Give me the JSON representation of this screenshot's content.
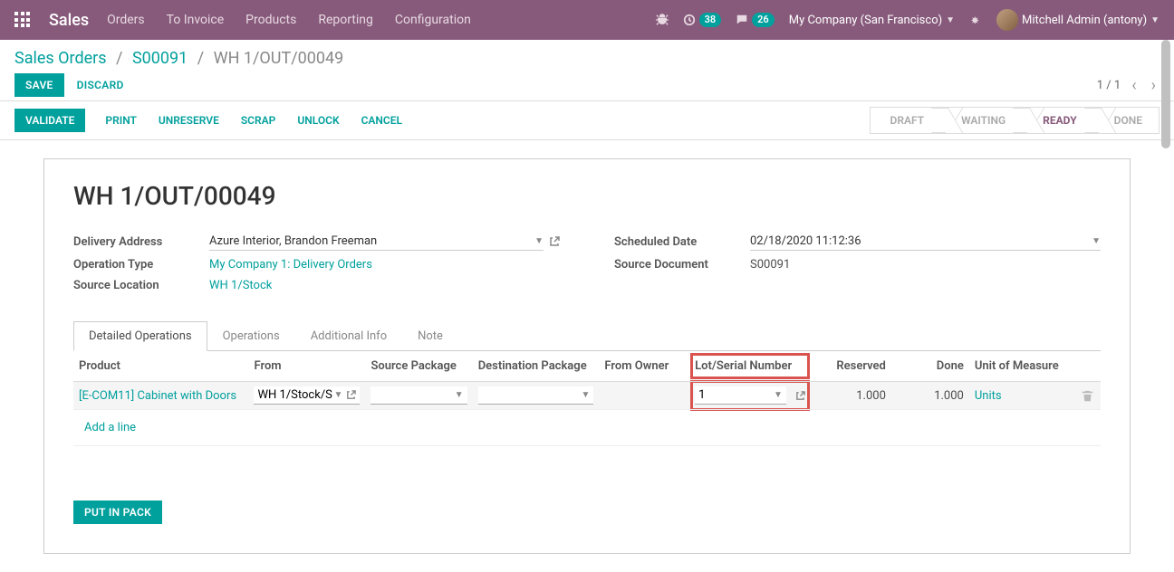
{
  "nav": {
    "brand": "Sales",
    "menu": [
      "Orders",
      "To Invoice",
      "Products",
      "Reporting",
      "Configuration"
    ],
    "activities_count": "38",
    "messages_count": "26",
    "company": "My Company (San Francisco)",
    "user": "Mitchell Admin (antony)"
  },
  "breadcrumb": {
    "level1": "Sales Orders",
    "level2": "S00091",
    "level3": "WH 1/OUT/00049"
  },
  "buttons": {
    "save": "SAVE",
    "discard": "DISCARD",
    "validate": "VALIDATE",
    "print": "PRINT",
    "unreserve": "UNRESERVE",
    "scrap": "SCRAP",
    "unlock": "UNLOCK",
    "cancel": "CANCEL",
    "put_in_pack": "PUT IN PACK"
  },
  "pager": {
    "text": "1 / 1"
  },
  "status": {
    "steps": [
      "DRAFT",
      "WAITING",
      "READY",
      "DONE"
    ],
    "active_index": 2
  },
  "record": {
    "title": "WH 1/OUT/00049",
    "delivery_address_label": "Delivery Address",
    "delivery_address": "Azure Interior, Brandon Freeman",
    "operation_type_label": "Operation Type",
    "operation_type": "My Company 1: Delivery Orders",
    "source_location_label": "Source Location",
    "source_location": "WH 1/Stock",
    "scheduled_date_label": "Scheduled Date",
    "scheduled_date": "02/18/2020 11:12:36",
    "source_document_label": "Source Document",
    "source_document": "S00091"
  },
  "tabs": [
    "Detailed Operations",
    "Operations",
    "Additional Info",
    "Note"
  ],
  "table": {
    "headers": {
      "product": "Product",
      "from": "From",
      "source_package": "Source Package",
      "destination_package": "Destination Package",
      "from_owner": "From Owner",
      "lot_serial": "Lot/Serial Number",
      "reserved": "Reserved",
      "done": "Done",
      "uom": "Unit of Measure"
    },
    "row": {
      "product": "[E-COM11] Cabinet with Doors",
      "from": "WH 1/Stock/S",
      "lot_serial": "1",
      "reserved": "1.000",
      "done": "1.000",
      "uom": "Units"
    },
    "add_line": "Add a line"
  }
}
